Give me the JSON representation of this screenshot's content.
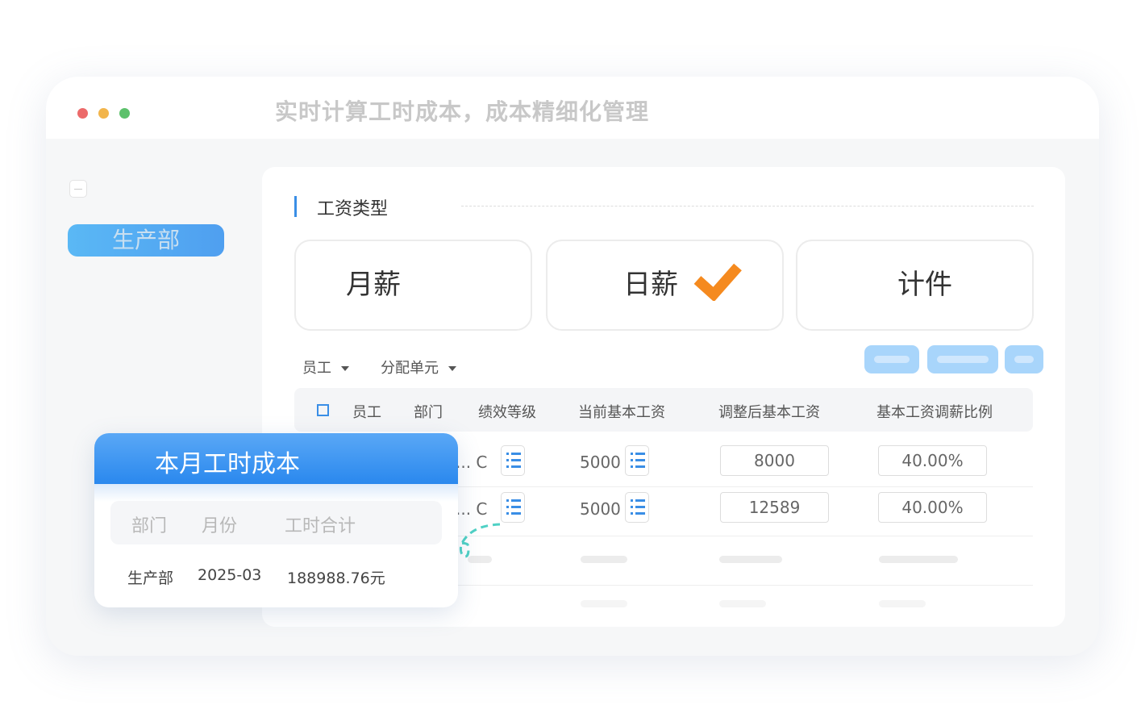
{
  "window": {
    "title": "实时计算工时成本，成本精细化管理",
    "dots": [
      "#ec6a6a",
      "#f2b54b",
      "#5cc16b"
    ]
  },
  "sidebar": {
    "department": "生产部"
  },
  "section": {
    "title": "工资类型"
  },
  "wage_types": [
    {
      "label": "月薪",
      "selected": false
    },
    {
      "label": "日薪",
      "selected": true
    },
    {
      "label": "计件",
      "selected": false
    }
  ],
  "filters": [
    {
      "label": "员工"
    },
    {
      "label": "分配单元"
    }
  ],
  "table": {
    "headers": [
      "员工",
      "部门",
      "绩效等级",
      "当前基本工资",
      "调整后基本工资",
      "基本工资调薪比例"
    ],
    "rows": [
      {
        "grade": "... C",
        "current": "5000",
        "adjusted": "8000",
        "ratio": "40.00%"
      },
      {
        "grade": "... C",
        "current": "5000",
        "adjusted": "12589",
        "ratio": "40.00%"
      }
    ]
  },
  "popup": {
    "title": "本月工时成本",
    "headers": [
      "部门",
      "月份",
      "工时合计"
    ],
    "row": {
      "dept": "生产部",
      "month": "2025-03",
      "total": "188988.76元"
    }
  },
  "colors": {
    "accent": "#3a8ee6",
    "check": "#f58a1f",
    "arrow": "#4fd1c5"
  }
}
